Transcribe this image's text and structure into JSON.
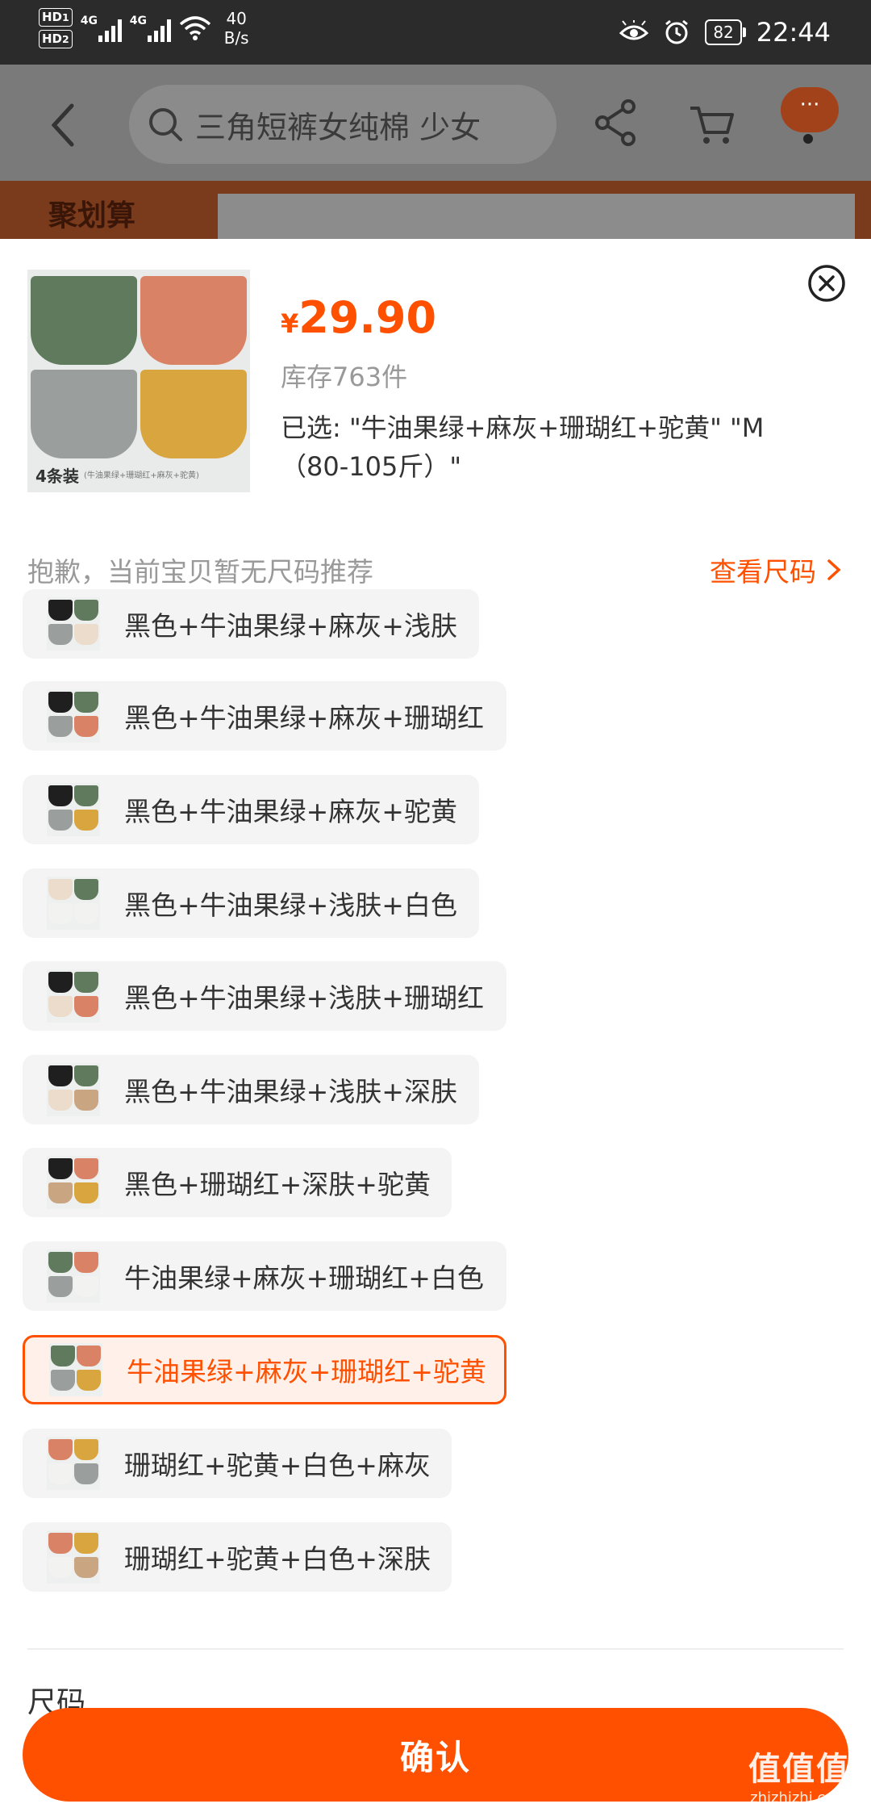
{
  "status_bar": {
    "hd1": "HD",
    "hd2": "HD",
    "sim1": "1",
    "sim2": "2",
    "signal1_label": "4G",
    "signal2_label": "4G",
    "net_speed": "40",
    "net_speed_unit": "B/s",
    "battery": "82",
    "time": "22:44"
  },
  "nav": {
    "search_text": "三角短裤女纯棉 少女",
    "more_label": "···",
    "banner_text": "聚划算"
  },
  "product": {
    "thumb_caption": "4条装",
    "thumb_subcaption": "(牛油果绿+珊瑚红+麻灰+驼黄)",
    "currency": "¥",
    "price": "29.90",
    "stock": "库存763件",
    "selected": "已选: \"牛油果绿+麻灰+珊瑚红+驼黄\" \"M（80-105斤）\""
  },
  "size_row": {
    "note": "抱歉，当前宝贝暂无尺码推荐",
    "link": "查看尺码"
  },
  "colors": {
    "black": "#1f1f1f",
    "avocado_green": "#5f7a5c",
    "gray": "#9a9e9c",
    "skin": "#ecdccb",
    "coral": "#d98266",
    "camel": "#d8a53f",
    "white": "#f2f2f0",
    "dark_skin": "#c9a582",
    "accent": "#ff5000"
  },
  "options": [
    {
      "label": "黑色+牛油果绿+麻灰+浅肤",
      "swatches": [
        "black",
        "avocado_green",
        "gray",
        "skin"
      ],
      "selected": false
    },
    {
      "label": "黑色+牛油果绿+麻灰+珊瑚红",
      "swatches": [
        "black",
        "avocado_green",
        "gray",
        "coral"
      ],
      "selected": false
    },
    {
      "label": "黑色+牛油果绿+麻灰+驼黄",
      "swatches": [
        "black",
        "avocado_green",
        "gray",
        "camel"
      ],
      "selected": false
    },
    {
      "label": "黑色+牛油果绿+浅肤+白色",
      "swatches": [
        "skin",
        "avocado_green",
        "white",
        "white"
      ],
      "selected": false
    },
    {
      "label": "黑色+牛油果绿+浅肤+珊瑚红",
      "swatches": [
        "black",
        "avocado_green",
        "skin",
        "coral"
      ],
      "selected": false
    },
    {
      "label": "黑色+牛油果绿+浅肤+深肤",
      "swatches": [
        "black",
        "avocado_green",
        "skin",
        "dark_skin"
      ],
      "selected": false
    },
    {
      "label": "黑色+珊瑚红+深肤+驼黄",
      "swatches": [
        "black",
        "coral",
        "dark_skin",
        "camel"
      ],
      "selected": false
    },
    {
      "label": "牛油果绿+麻灰+珊瑚红+白色",
      "swatches": [
        "avocado_green",
        "coral",
        "gray",
        "white"
      ],
      "selected": false
    },
    {
      "label": "牛油果绿+麻灰+珊瑚红+驼黄",
      "swatches": [
        "avocado_green",
        "coral",
        "gray",
        "camel"
      ],
      "selected": true
    },
    {
      "label": "珊瑚红+驼黄+白色+麻灰",
      "swatches": [
        "coral",
        "camel",
        "white",
        "gray"
      ],
      "selected": false
    },
    {
      "label": "珊瑚红+驼黄+白色+深肤",
      "swatches": [
        "coral",
        "camel",
        "white",
        "dark_skin"
      ],
      "selected": false
    }
  ],
  "section_label": "尺码",
  "confirm_label": "确认",
  "watermark": {
    "main": "值值值",
    "sub": "zhizhizhi.com"
  }
}
